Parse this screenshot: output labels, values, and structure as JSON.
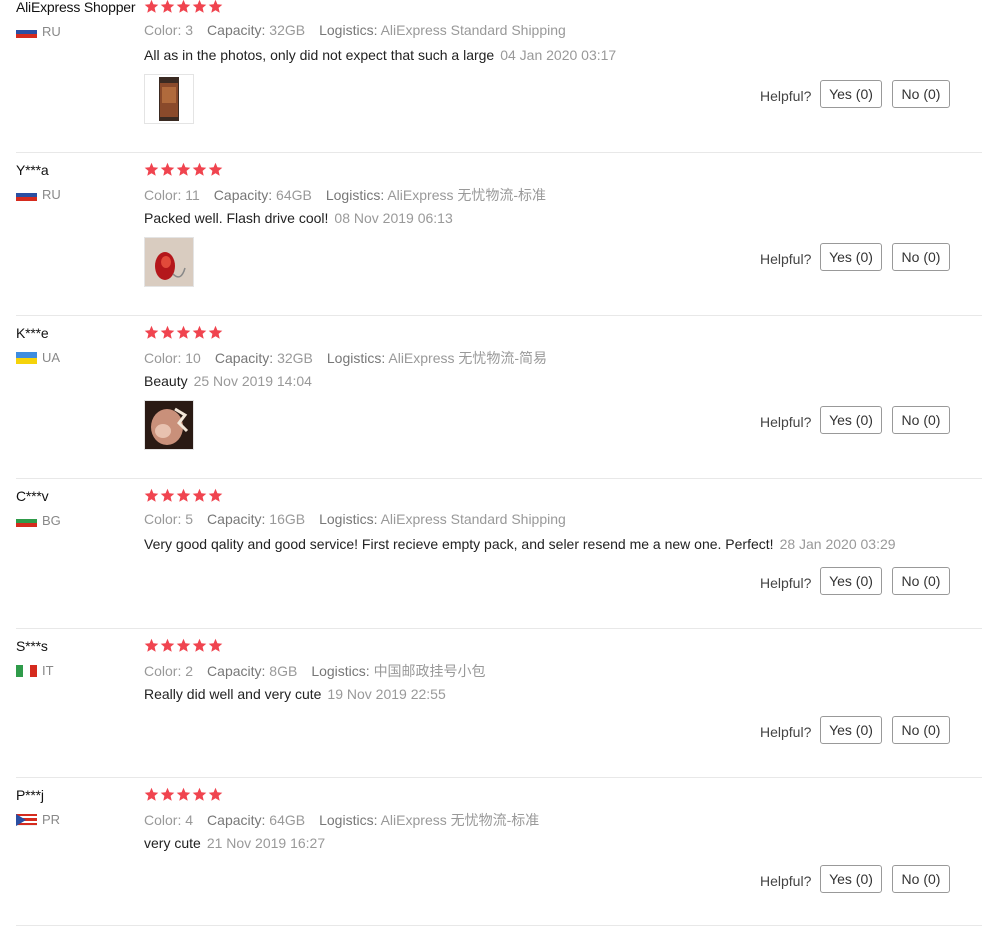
{
  "reviews": [
    {
      "user": "AliExpress Shopper",
      "country": "RU",
      "flag": [
        "#ffffff",
        "#2a4fa3",
        "#d52b1e"
      ],
      "stars": 5,
      "color_label": "Color:",
      "color": "3",
      "capacity_label": "Capacity:",
      "capacity": "32GB",
      "logistics_label": "Logistics:",
      "logistics": "AliExpress Standard Shipping",
      "text": "All as in the photos, only did not expect that such a large",
      "date": "04 Jan 2020 03:17",
      "has_photo": true,
      "helpful_label": "Helpful?",
      "yes_label": "Yes (0)",
      "no_label": "No (0)"
    },
    {
      "user": "Y***a",
      "country": "RU",
      "flag": [
        "#ffffff",
        "#2a4fa3",
        "#d52b1e"
      ],
      "stars": 5,
      "color_label": "Color:",
      "color": "11",
      "capacity_label": "Capacity:",
      "capacity": "64GB",
      "logistics_label": "Logistics:",
      "logistics": "AliExpress 无忧物流-标准",
      "text": "Packed well. Flash drive cool!",
      "date": "08 Nov 2019 06:13",
      "has_photo": true,
      "helpful_label": "Helpful?",
      "yes_label": "Yes (0)",
      "no_label": "No (0)"
    },
    {
      "user": "K***e",
      "country": "UA",
      "flag": [
        "#3d8de0",
        "#f5d30a"
      ],
      "stars": 5,
      "color_label": "Color:",
      "color": "10",
      "capacity_label": "Capacity:",
      "capacity": "32GB",
      "logistics_label": "Logistics:",
      "logistics": "AliExpress 无忧物流-简易",
      "text": "Beauty",
      "date": "25 Nov 2019 14:04",
      "has_photo": true,
      "helpful_label": "Helpful?",
      "yes_label": "Yes (0)",
      "no_label": "No (0)"
    },
    {
      "user": "C***v",
      "country": "BG",
      "flag": [
        "#ffffff",
        "#2f9b4a",
        "#d52b1e"
      ],
      "stars": 5,
      "color_label": "Color:",
      "color": "5",
      "capacity_label": "Capacity:",
      "capacity": "16GB",
      "logistics_label": "Logistics:",
      "logistics": "AliExpress Standard Shipping",
      "text": "Very good qality and good service! First recieve empty pack, and seler resend me a new one. Perfect!",
      "date": "28 Jan 2020 03:29",
      "has_photo": false,
      "helpful_label": "Helpful?",
      "yes_label": "Yes (0)",
      "no_label": "No (0)"
    },
    {
      "user": "S***s",
      "country": "IT",
      "flag": [
        "#2f9b4a",
        "#ffffff",
        "#d52b1e"
      ],
      "stars": 5,
      "color_label": "Color:",
      "color": "2",
      "capacity_label": "Capacity:",
      "capacity": "8GB",
      "logistics_label": "Logistics:",
      "logistics": "中国邮政挂号小包",
      "text": "Really did well and very cute",
      "date": "19 Nov 2019 22:55",
      "has_photo": false,
      "helpful_label": "Helpful?",
      "yes_label": "Yes (0)",
      "no_label": "No (0)"
    },
    {
      "user": "P***j",
      "country": "PR",
      "flag": [
        "#d52b1e",
        "#ffffff",
        "#2a4fa3"
      ],
      "stars": 5,
      "color_label": "Color:",
      "color": "4",
      "capacity_label": "Capacity:",
      "capacity": "64GB",
      "logistics_label": "Logistics:",
      "logistics": "AliExpress 无忧物流-标准",
      "text": "very cute",
      "date": "21 Nov 2019 16:27",
      "has_photo": false,
      "helpful_label": "Helpful?",
      "yes_label": "Yes (0)",
      "no_label": "No (0)"
    }
  ],
  "colors": {
    "star": "#f0444f",
    "divider": "#e8e8e8",
    "muted": "#999999"
  }
}
